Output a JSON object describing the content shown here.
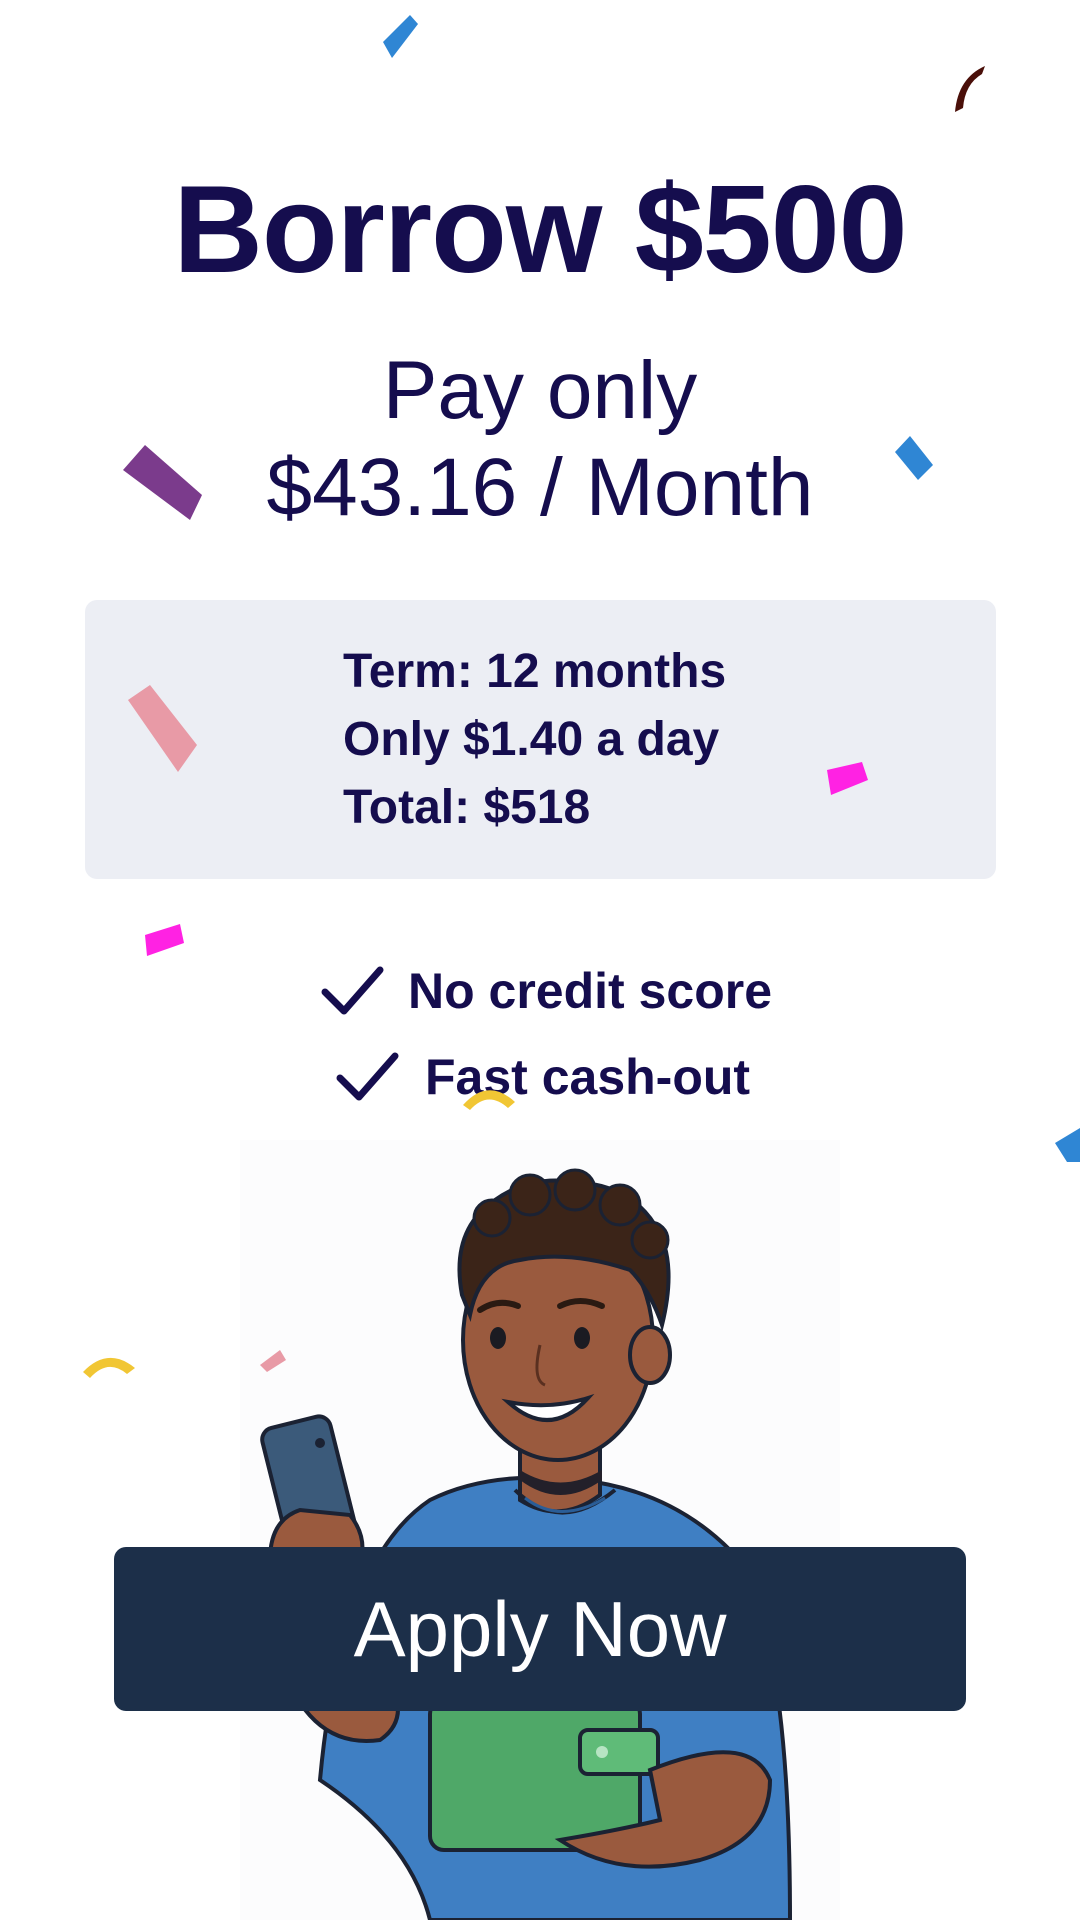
{
  "headline": "Borrow $500",
  "subheadline_line1": "Pay only",
  "subheadline_line2": "$43.16 / Month",
  "terms": [
    "Term: 12 months",
    "Only $1.40 a day",
    "Total: $518"
  ],
  "features": [
    "No credit score",
    "Fast cash-out"
  ],
  "cta_label": "Apply Now",
  "icons": {
    "feature_bullet": "check-icon",
    "illustration": "man-with-phone-and-wallet",
    "decoration": "confetti"
  },
  "colors": {
    "text_primary": "#150d4e",
    "terms_background": "#eceef4",
    "cta_background": "#1c2f49",
    "cta_text": "#ffffff"
  }
}
